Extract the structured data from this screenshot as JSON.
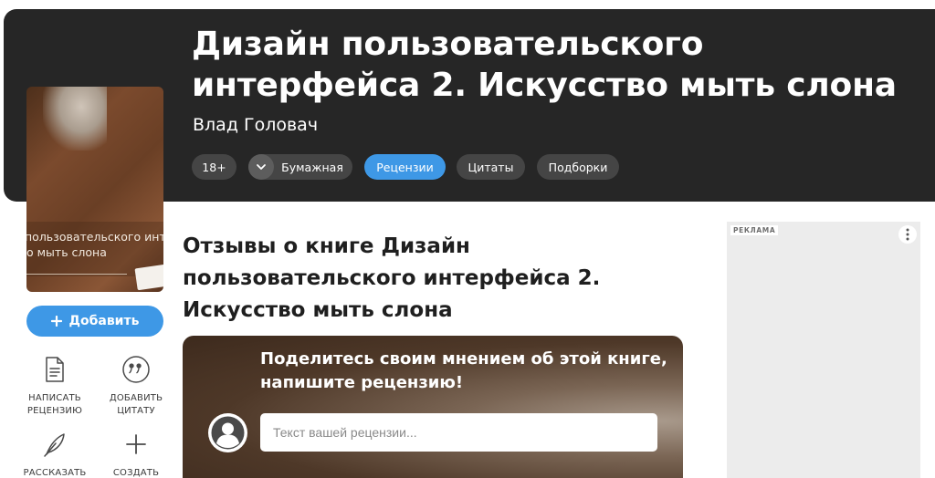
{
  "book": {
    "title": "Дизайн пользовательского интерфейса 2. Искусство мыть слона",
    "author": "Влад Головач"
  },
  "chips": {
    "age": "18+",
    "format": "Бумажная",
    "reviews": "Рецензии",
    "quotes": "Цитаты",
    "collections": "Подборки"
  },
  "cover": {
    "line1": "пользовательского интерф",
    "line2": "о мыть слона"
  },
  "sidebar": {
    "add_button_label": "Добавить",
    "actions": [
      {
        "label": "НАПИСАТЬ РЕЦЕНЗИЮ",
        "icon": "document-icon"
      },
      {
        "label": "ДОБАВИТЬ ЦИТАТУ",
        "icon": "quote-icon"
      },
      {
        "label": "РАССКАЗАТЬ",
        "icon": "feather-icon"
      },
      {
        "label": "СОЗДАТЬ",
        "icon": "plus-icon"
      }
    ]
  },
  "reviews_section": {
    "heading": "Отзывы о книге Дизайн пользовательского интерфейса 2. Искусство мыть слона"
  },
  "share_card": {
    "headline": "Поделитесь своим мнением об этой книге, напишите рецензию!",
    "input_placeholder": "Текст вашей рецензии..."
  },
  "ad": {
    "label": "РЕКЛАМА"
  },
  "colors": {
    "header_bg": "#262626",
    "accent_blue": "#3e98e6",
    "chip_bg": "#454545"
  }
}
